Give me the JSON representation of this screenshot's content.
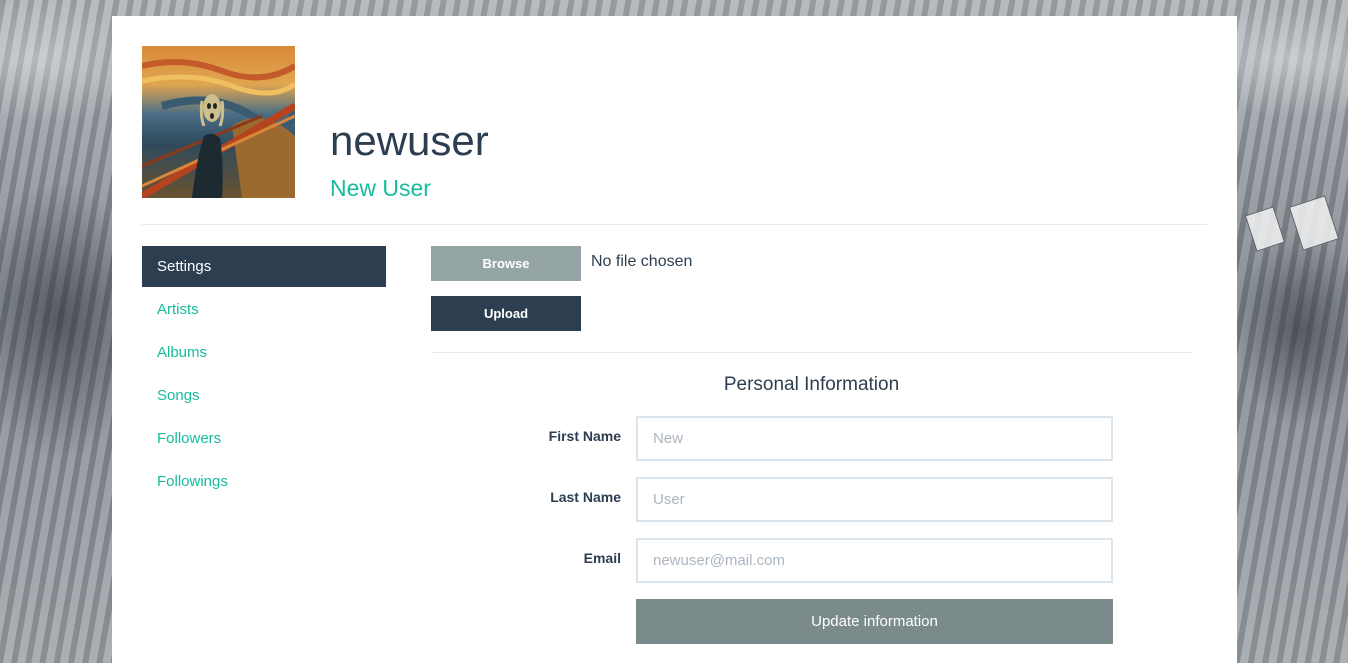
{
  "profile": {
    "username": "newuser",
    "full_name": "New User",
    "avatar_icon": "scream-painting-avatar"
  },
  "sidebar": {
    "items": [
      {
        "label": "Settings",
        "active": true
      },
      {
        "label": "Artists",
        "active": false
      },
      {
        "label": "Albums",
        "active": false
      },
      {
        "label": "Songs",
        "active": false
      },
      {
        "label": "Followers",
        "active": false
      },
      {
        "label": "Followings",
        "active": false
      }
    ]
  },
  "upload": {
    "browse_label": "Browse",
    "file_status": "No file chosen",
    "upload_label": "Upload"
  },
  "personal_info": {
    "title": "Personal Information",
    "first_name": {
      "label": "First Name",
      "placeholder": "New"
    },
    "last_name": {
      "label": "Last Name",
      "placeholder": "User"
    },
    "email": {
      "label": "Email",
      "placeholder": "newuser@mail.com"
    },
    "submit_label": "Update information"
  },
  "colors": {
    "primary": "#2c3e50",
    "accent": "#18bc9c",
    "muted_button": "#95a5a6",
    "update_button": "#7b8a8b",
    "input_border": "#dce4ec"
  }
}
